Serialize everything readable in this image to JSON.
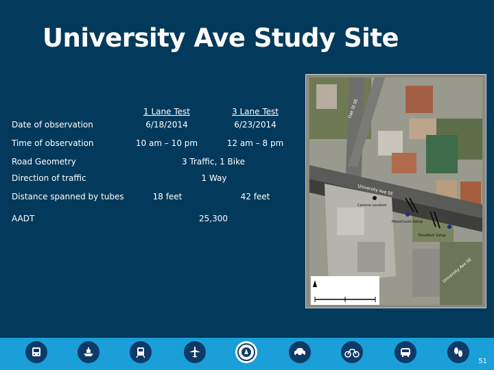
{
  "slide": {
    "title": "University Ave Study Site",
    "page_number": "51"
  },
  "table": {
    "columns": [
      "1 Lane Test",
      "3 Lane Test"
    ],
    "rows": [
      {
        "label": "Date of observation",
        "col1": "6/18/2014",
        "col2": "6/23/2014"
      },
      {
        "label": "Time of observation",
        "col1": "10 am – 10 pm",
        "col2": "12 am – 8 pm"
      },
      {
        "label": "Road Geometry",
        "merged": "3 Traffic, 1 Bike"
      },
      {
        "label": "Direction of traffic",
        "merged": "1 Way"
      },
      {
        "label": "Distance spanned by tubes",
        "col1": "18 feet",
        "col2": "42 feet"
      },
      {
        "label": "AADT",
        "merged": "25,300"
      }
    ]
  },
  "map": {
    "street_label_top": "Oak St SE",
    "street_label_middle": "University Ave SE",
    "street_label_bottom": "University Ave SE",
    "camera_label": "Camera Location",
    "metrocount_label": "MetroCount Setup",
    "timemark_label": "TimeMark Setup"
  },
  "footer": {
    "icons": [
      "bus-icon",
      "ship-icon",
      "train-icon",
      "airplane-icon",
      "mndot-seal-icon",
      "car-icon",
      "bicycle-icon",
      "transit-bus-icon",
      "footprints-icon"
    ],
    "bar_color": "#1a9fd8",
    "icon_color": "#0e3a67"
  }
}
